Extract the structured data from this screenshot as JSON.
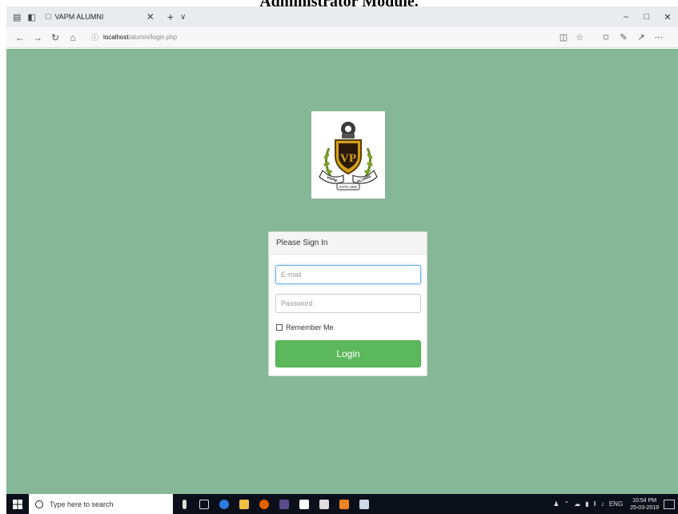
{
  "document_heading": "Administrator Module.",
  "browser": {
    "tab_title": "VAPM ALUMNI",
    "url_host": "localhost",
    "url_path": "/alumni/login.php"
  },
  "logo": {
    "upper_banner_left": "VAPM",
    "upper_banner_right": "ALUMNI",
    "lower_banner": "ESTD 2006"
  },
  "login": {
    "panel_title": "Please Sign In",
    "email_placeholder": "E-mail",
    "password_placeholder": "Password",
    "remember_label": "Remember Me",
    "login_label": "Login"
  },
  "taskbar": {
    "search_placeholder": "Type here to search",
    "language": "ENG",
    "time": "10:54 PM",
    "date": "25-03-2019"
  },
  "colors": {
    "page_background": "#86b797",
    "login_button": "#5cb85c",
    "taskbar": "#0b0f1a"
  }
}
